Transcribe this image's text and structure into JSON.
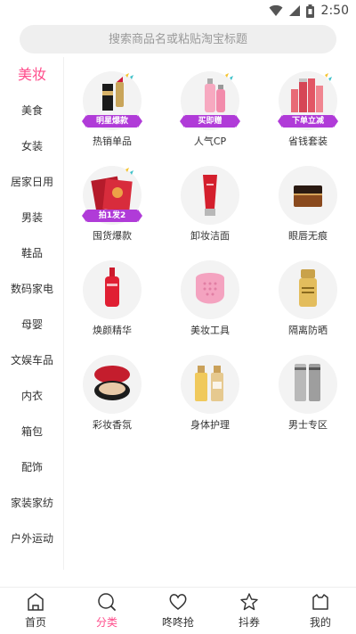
{
  "status_bar": {
    "time": "2:50",
    "wifi_icon": "wifi-icon",
    "signal_icon": "signal-icon",
    "battery_icon": "battery-icon"
  },
  "search": {
    "placeholder": "搜索商品名或粘贴淘宝标题"
  },
  "sidebar": {
    "items": [
      {
        "label": "美妆",
        "active": true
      },
      {
        "label": "美食"
      },
      {
        "label": "女装"
      },
      {
        "label": "居家日用"
      },
      {
        "label": "男装"
      },
      {
        "label": "鞋品"
      },
      {
        "label": "数码家电"
      },
      {
        "label": "母婴"
      },
      {
        "label": "文娱车品"
      },
      {
        "label": "内衣"
      },
      {
        "label": "箱包"
      },
      {
        "label": "配饰"
      },
      {
        "label": "家装家纺"
      },
      {
        "label": "户外运动"
      }
    ]
  },
  "grid": {
    "items": [
      {
        "label": "热销单品",
        "badge": "明星爆款",
        "icon": "lipstick-icon"
      },
      {
        "label": "人气CP",
        "badge": "买即赠",
        "icon": "pink-bottles-icon"
      },
      {
        "label": "省钱套装",
        "badge": "下单立减",
        "icon": "skincare-set-icon"
      },
      {
        "label": "囤货爆款",
        "badge": "拍1发2",
        "icon": "face-mask-icon"
      },
      {
        "label": "卸妆洁面",
        "icon": "cleanser-tube-icon"
      },
      {
        "label": "眼唇无痕",
        "icon": "eye-cream-jar-icon"
      },
      {
        "label": "焕颜精华",
        "icon": "serum-bottle-icon"
      },
      {
        "label": "美妆工具",
        "icon": "cleansing-brush-icon"
      },
      {
        "label": "隔离防晒",
        "icon": "sunscreen-bottle-icon"
      },
      {
        "label": "彩妆香氛",
        "icon": "cushion-compact-icon"
      },
      {
        "label": "身体护理",
        "icon": "body-lotion-icon"
      },
      {
        "label": "男士专区",
        "icon": "mens-bottles-icon"
      }
    ]
  },
  "bottom_nav": {
    "items": [
      {
        "label": "首页",
        "icon": "home-icon"
      },
      {
        "label": "分类",
        "icon": "category-search-icon",
        "active": true
      },
      {
        "label": "咚咚抢",
        "icon": "heart-icon"
      },
      {
        "label": "抖券",
        "icon": "star-icon"
      },
      {
        "label": "我的",
        "icon": "profile-icon"
      }
    ]
  },
  "colors": {
    "accent": "#ff4c8b",
    "badge": "#b03bd8",
    "thumb_bg": "#f3f3f3"
  }
}
